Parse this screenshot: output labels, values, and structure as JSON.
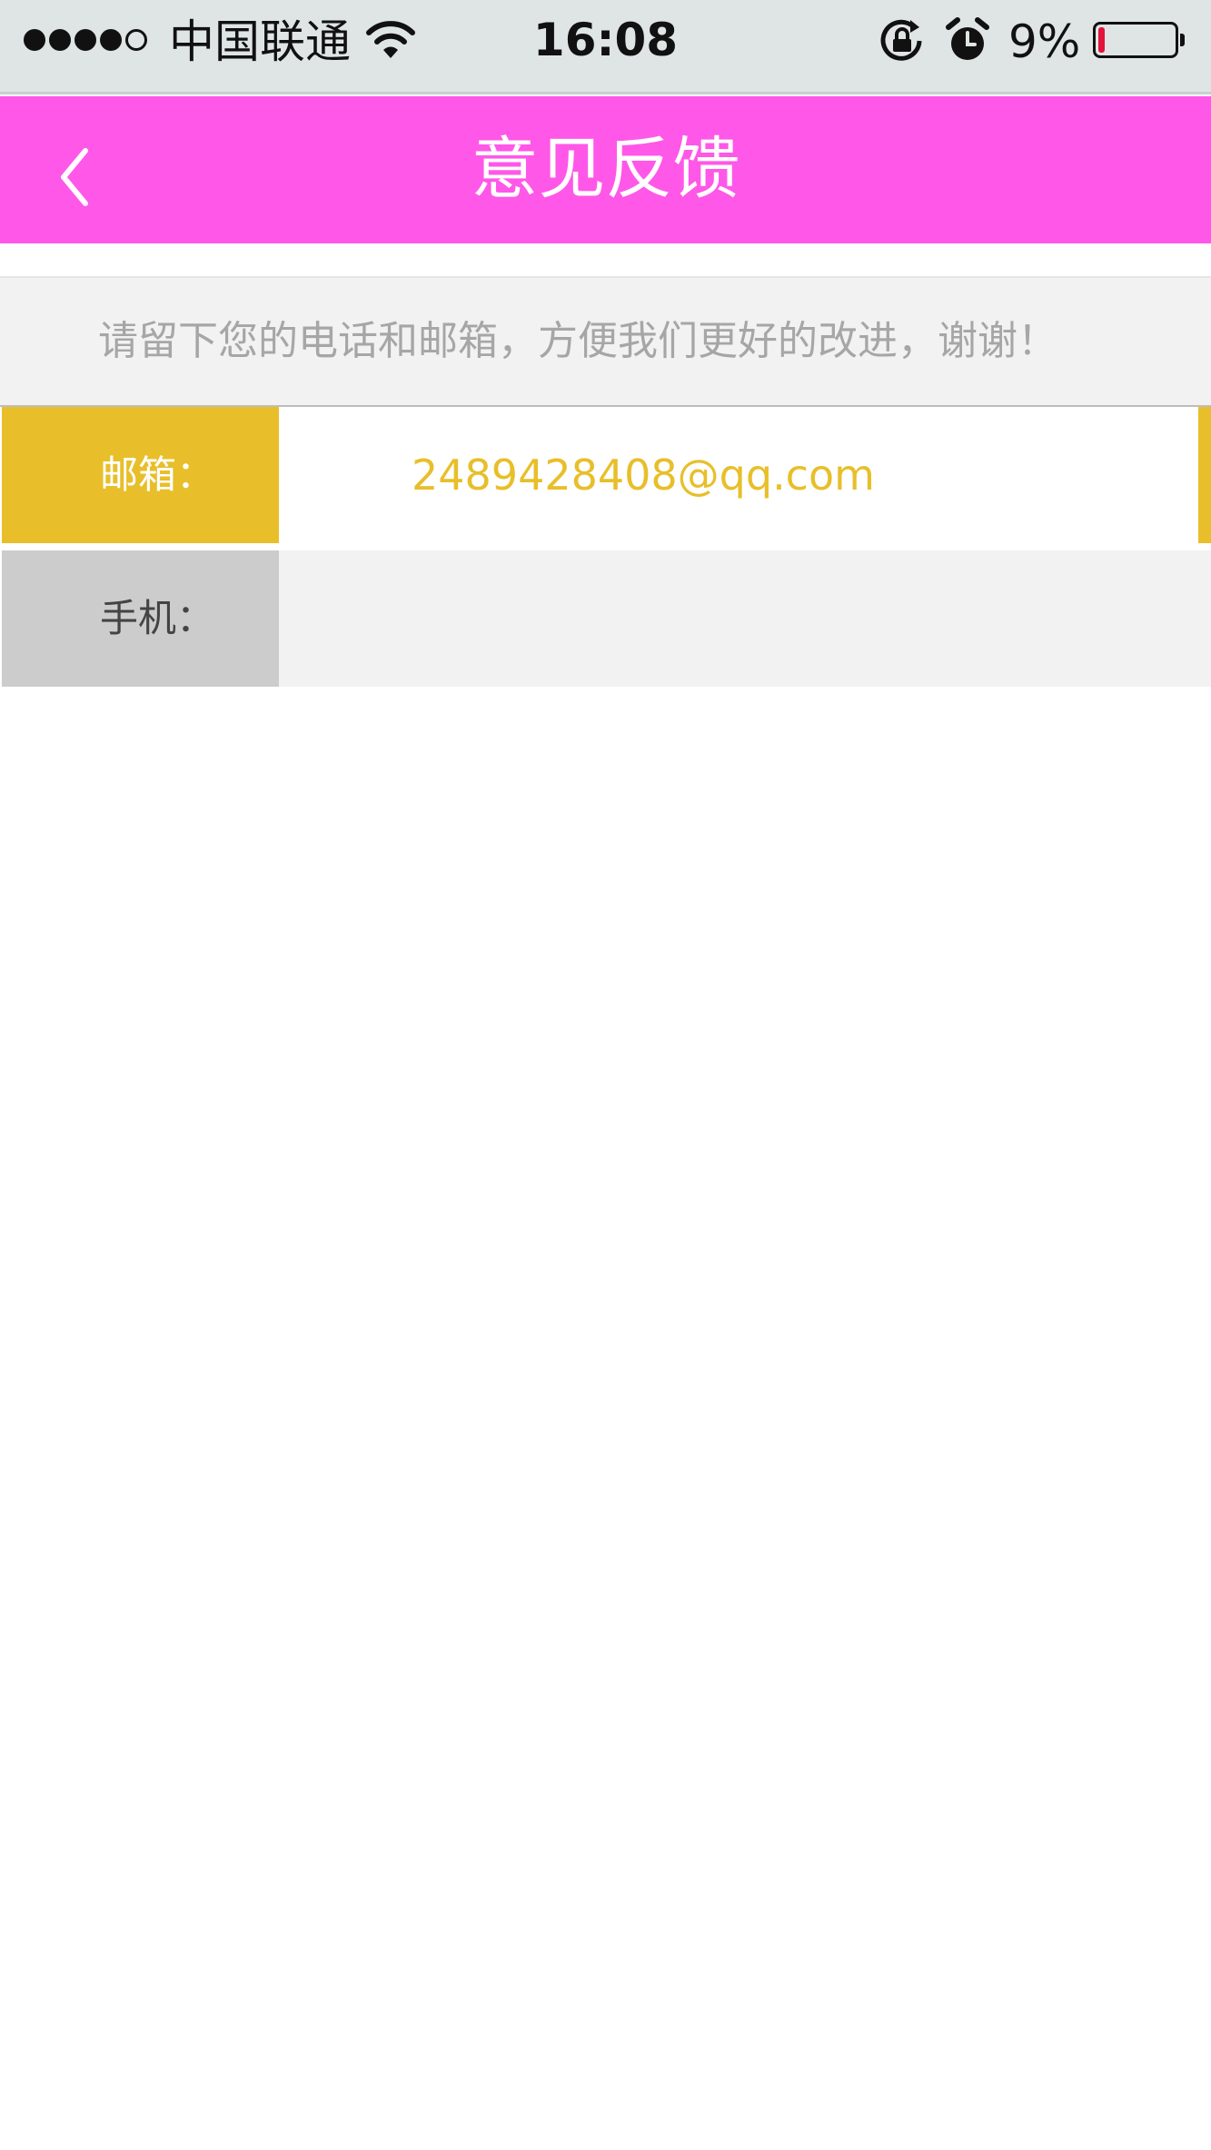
{
  "status_bar": {
    "carrier": "中国联通",
    "time": "16:08",
    "battery_percent": "9%",
    "battery_level": 0.09,
    "signal_strength": 4,
    "signal_max": 5,
    "icons": [
      "signal-dots-icon",
      "wifi-icon",
      "rotation-lock-icon",
      "alarm-icon",
      "battery-icon"
    ]
  },
  "nav": {
    "title": "意见反馈",
    "back_icon": "chevron-left-icon",
    "background_color": "#ff57e8"
  },
  "hint": {
    "text": "请留下您的电话和邮箱，方便我们更好的改进，谢谢！"
  },
  "form": {
    "email": {
      "label": "邮箱：",
      "value": "2489428408@qq.com",
      "accent_color": "#e8bf2a"
    },
    "phone": {
      "label": "手机：",
      "value": ""
    }
  }
}
